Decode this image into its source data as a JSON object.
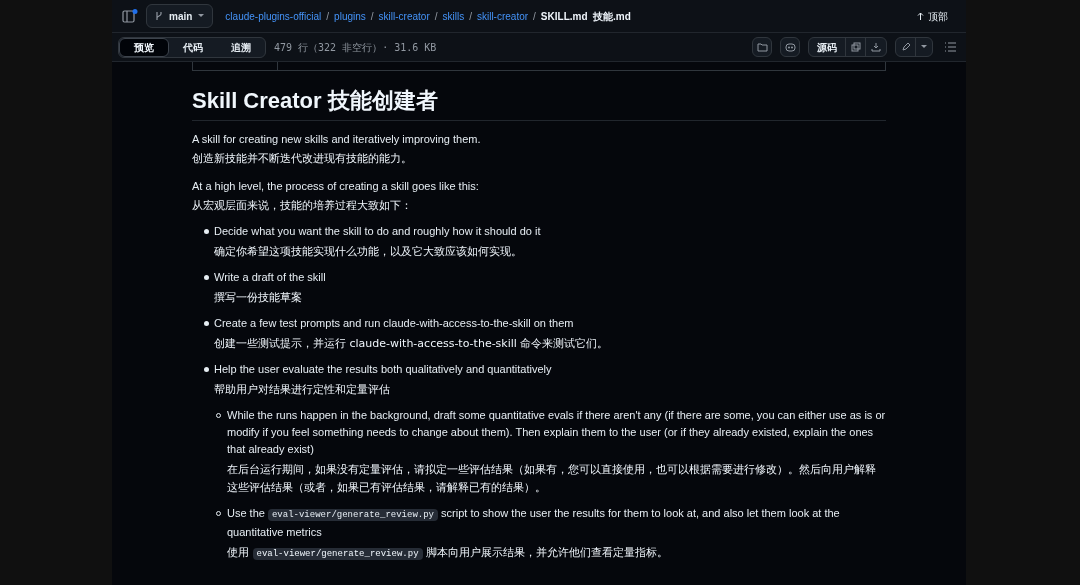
{
  "header": {
    "branch": "main",
    "breadcrumb": [
      {
        "text": "claude-plugins-official",
        "kind": "link"
      },
      {
        "text": "/",
        "kind": "separator"
      },
      {
        "text": "plugins",
        "kind": "link"
      },
      {
        "text": "/",
        "kind": "separator"
      },
      {
        "text": "skill-creator",
        "kind": "link"
      },
      {
        "text": "/",
        "kind": "separator"
      },
      {
        "text": "skills",
        "kind": "link"
      },
      {
        "text": "/",
        "kind": "separator"
      },
      {
        "text": "skill-creator",
        "kind": "link"
      },
      {
        "text": "/",
        "kind": "separator"
      },
      {
        "text": "SKILL.md  技能.md",
        "kind": "current"
      }
    ],
    "top_link": "顶部"
  },
  "toolbar": {
    "tabs": [
      {
        "label": "预览",
        "selected": true
      },
      {
        "label": "代码",
        "selected": false
      },
      {
        "label": "追溯",
        "selected": false
      }
    ],
    "file_info": "479 行（322 非空行）· 31.6 KB",
    "raw_button": "源码"
  },
  "document": {
    "title": "Skill Creator  技能创建者",
    "paragraphs": [
      {
        "en": "A skill for creating new skills and iteratively improving them.",
        "zh": "创造新技能并不断迭代改进现有技能的能力。"
      },
      {
        "en": "At a high level, the process of creating a skill goes like this:",
        "zh": "从宏观层面来说，技能的培养过程大致如下："
      }
    ],
    "list": [
      {
        "en": [
          {
            "kind": "text",
            "text": "Decide what you want the skill to do and roughly how it should do it"
          }
        ],
        "zh": [
          {
            "kind": "text",
            "text": "确定你希望这项技能实现什么功能，以及它大致应该如何实现。"
          }
        ]
      },
      {
        "en": [
          {
            "kind": "text",
            "text": "Write a draft of the skill"
          }
        ],
        "zh": [
          {
            "kind": "text",
            "text": "撰写一份技能草案"
          }
        ]
      },
      {
        "en": [
          {
            "kind": "text",
            "text": "Create a few test prompts and run claude-with-access-to-the-skill on them"
          }
        ],
        "zh": [
          {
            "kind": "text",
            "text": "创建一些测试提示，并运行 claude-with-access-to-the-skill 命令来测试它们。"
          }
        ]
      },
      {
        "en": [
          {
            "kind": "text",
            "text": "Help the user evaluate the results both qualitatively and quantitatively"
          }
        ],
        "zh": [
          {
            "kind": "text",
            "text": "帮助用户对结果进行定性和定量评估"
          }
        ],
        "children": [
          {
            "en": [
              {
                "kind": "text",
                "text": "While the runs happen in the background, draft some quantitative evals if there aren't any (if there are some, you can either use as is or modify if you feel something needs to change about them). Then explain them to the user (or if they already existed, explain the ones that already exist)"
              }
            ],
            "zh": [
              {
                "kind": "text",
                "text": "在后台运行期间，如果没有定量评估，请拟定一些评估结果（如果有，您可以直接使用，也可以根据需要进行修改）。然后向用户解释这些评估结果（或者，如果已有评估结果，请解释已有的结果）。"
              }
            ]
          },
          {
            "en": [
              {
                "kind": "text",
                "text": "Use the "
              },
              {
                "kind": "code",
                "text": "eval-viewer/generate_review.py"
              },
              {
                "kind": "text",
                "text": " script to show the user the results for them to look at, and also let them look at the quantitative metrics"
              }
            ],
            "zh": [
              {
                "kind": "text",
                "text": "使用 "
              },
              {
                "kind": "code",
                "text": "eval-viewer/generate_review.py"
              },
              {
                "kind": "text",
                "text": " 脚本向用户展示结果，并允许他们查看定量指标。"
              }
            ]
          }
        ]
      }
    ]
  }
}
